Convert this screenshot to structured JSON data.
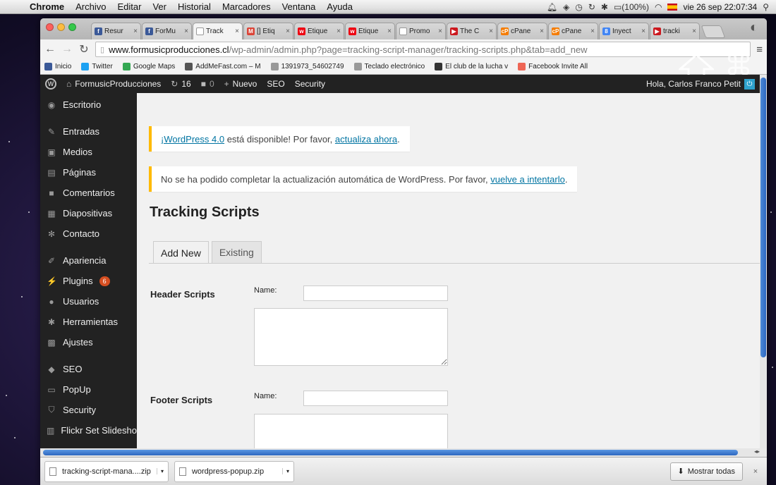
{
  "menubar": {
    "app": "Chrome",
    "items": [
      "Archivo",
      "Editar",
      "Ver",
      "Historial",
      "Marcadores",
      "Ventana",
      "Ayuda"
    ],
    "battery": "(100%)",
    "clock": "vie 26 sep  22:07:34"
  },
  "tabs": [
    {
      "title": "Resur",
      "color": "#3b5998",
      "glyph": "f"
    },
    {
      "title": "ForMu",
      "color": "#3b5998",
      "glyph": "f"
    },
    {
      "title": "Track",
      "color": "#ffffff",
      "glyph": "",
      "active": true
    },
    {
      "title": "[] Etiq",
      "color": "#db4437",
      "glyph": "M"
    },
    {
      "title": "Etique",
      "color": "#e01",
      "glyph": "w"
    },
    {
      "title": "Etique",
      "color": "#e01",
      "glyph": "w"
    },
    {
      "title": "Promo",
      "color": "#ffffff",
      "glyph": ""
    },
    {
      "title": "The C",
      "color": "#cc181e",
      "glyph": "▶"
    },
    {
      "title": "cPane",
      "color": "#f57c00",
      "glyph": "cP"
    },
    {
      "title": "cPane",
      "color": "#f57c00",
      "glyph": "cP"
    },
    {
      "title": "Inyect",
      "color": "#4285f4",
      "glyph": "8"
    },
    {
      "title": "tracki",
      "color": "#cc181e",
      "glyph": "▶"
    }
  ],
  "address": {
    "host": "www.formusicproducciones.cl",
    "path": "/wp-admin/admin.php?page=tracking-script-manager/tracking-scripts.php&tab=add_new"
  },
  "bookmarks": [
    {
      "label": "Inicio",
      "color": "#3b5998"
    },
    {
      "label": "Twitter",
      "color": "#1da1f2"
    },
    {
      "label": "Google Maps",
      "color": "#34a853"
    },
    {
      "label": "AddMeFast.com – M",
      "color": "#555"
    },
    {
      "label": "1391973_54602749",
      "color": "#999"
    },
    {
      "label": "Teclado electrónico",
      "color": "#999"
    },
    {
      "label": "El club de la lucha v",
      "color": "#333"
    },
    {
      "label": "Facebook Invite All",
      "color": "#e65"
    }
  ],
  "adminbar": {
    "site": "FormusicProducciones",
    "updates": "16",
    "comments": "0",
    "new": "Nuevo",
    "seo": "SEO",
    "security": "Security",
    "greeting": "Hola, Carlos Franco Petit"
  },
  "sidebar": [
    {
      "label": "Escritorio",
      "icon": "◉"
    },
    {
      "label": "Entradas",
      "icon": "✎",
      "gap": true
    },
    {
      "label": "Medios",
      "icon": "▣"
    },
    {
      "label": "Páginas",
      "icon": "▤"
    },
    {
      "label": "Comentarios",
      "icon": "■"
    },
    {
      "label": "Diapositivas",
      "icon": "▦"
    },
    {
      "label": "Contacto",
      "icon": "✻"
    },
    {
      "label": "Apariencia",
      "icon": "✐",
      "gap": true
    },
    {
      "label": "Plugins",
      "icon": "⚡",
      "badge": "6"
    },
    {
      "label": "Usuarios",
      "icon": "●"
    },
    {
      "label": "Herramientas",
      "icon": "✱"
    },
    {
      "label": "Ajustes",
      "icon": "▩"
    },
    {
      "label": "SEO",
      "icon": "◆",
      "gap": true
    },
    {
      "label": "PopUp",
      "icon": "▭"
    },
    {
      "label": "Security",
      "icon": "⛉"
    },
    {
      "label": "Flickr Set Slideshows",
      "icon": "▥"
    }
  ],
  "notices": {
    "update": {
      "link": "¡WordPress 4.0",
      "middle": " está disponible! Por favor, ",
      "action": "actualiza ahora",
      "end": "."
    },
    "failed": {
      "text": "No se ha podido completar la actualización automática de WordPress. Por favor, ",
      "action": "vuelve a intentarlo",
      "end": "."
    }
  },
  "page": {
    "title": "Tracking Scripts",
    "tabs": [
      "Add New",
      "Existing"
    ],
    "header_label": "Header Scripts",
    "footer_label": "Footer Scripts",
    "name_label": "Name:"
  },
  "downloads": {
    "files": [
      "tracking-script-mana....zip",
      "wordpress-popup.zip"
    ],
    "show_all": "Mostrar todas"
  }
}
